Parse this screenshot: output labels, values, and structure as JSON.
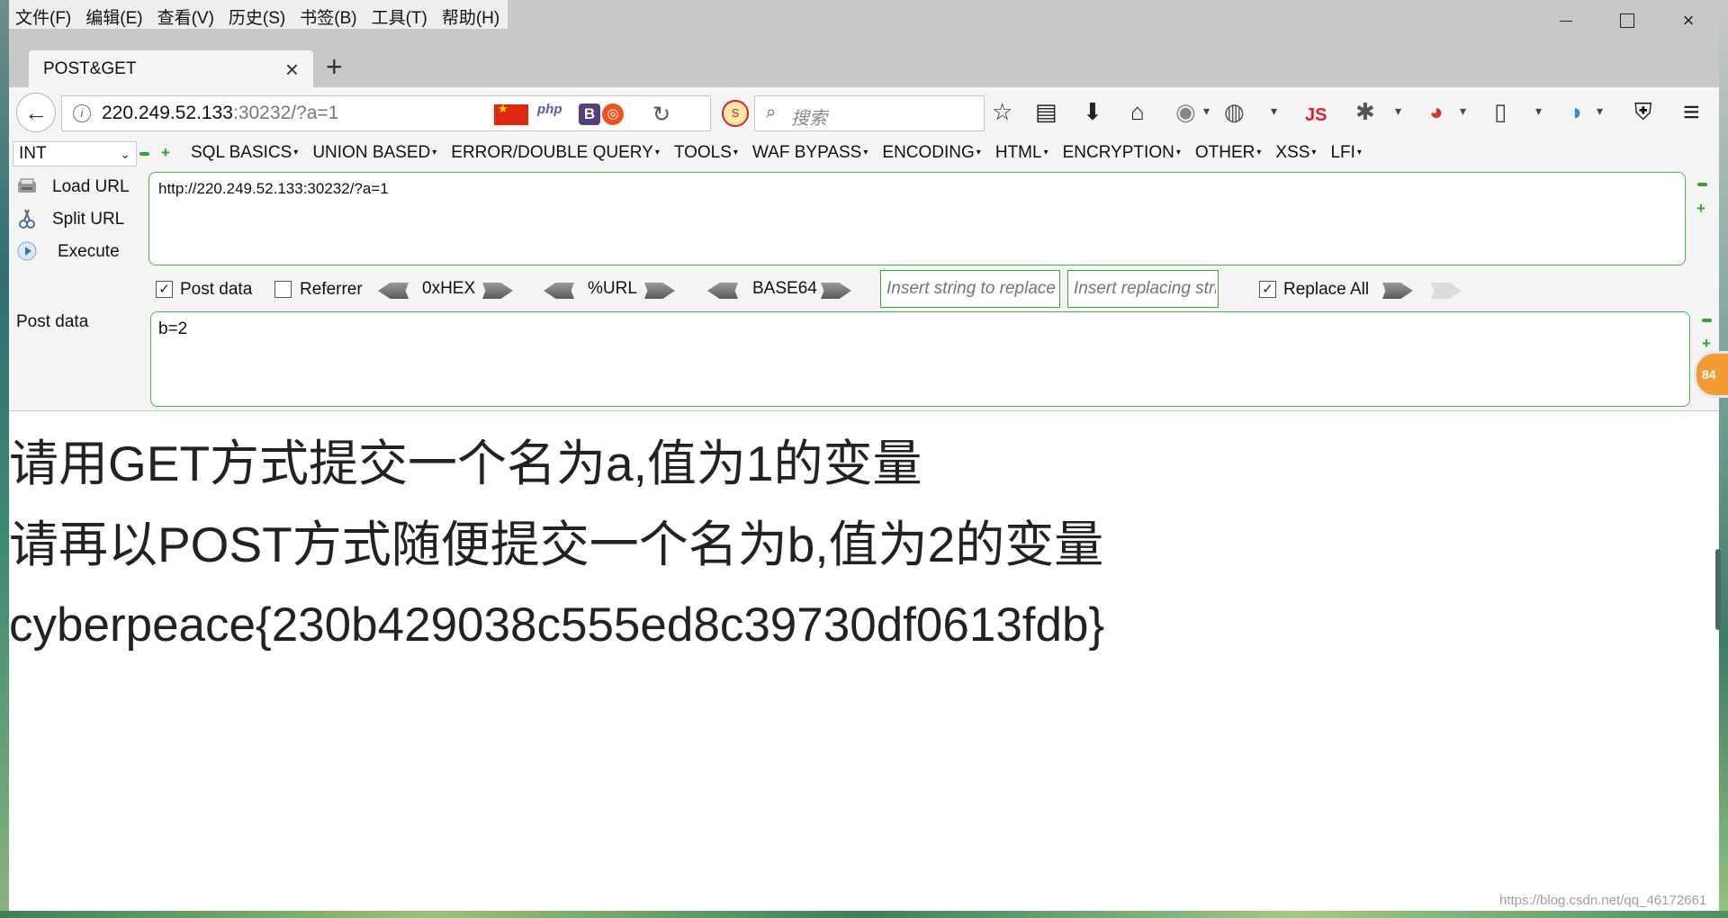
{
  "menu": [
    "文件(F)",
    "编辑(E)",
    "查看(V)",
    "历史(S)",
    "书签(B)",
    "工具(T)",
    "帮助(H)"
  ],
  "window": {
    "close_glyph": "×"
  },
  "tab": {
    "title": "POST&GET",
    "close_glyph": "×",
    "new_tab_glyph": "+"
  },
  "nav": {
    "back_glyph": "←",
    "info_glyph": "i",
    "url_host": "220.249.52.133",
    "url_rest": ":30232/?a=1",
    "php_label": "php",
    "b_label": "B",
    "ubuntu_glyph": "◎",
    "reload_glyph": "↻",
    "noscript_label": "S",
    "search_placeholder": "搜索",
    "search_glyph": "⌕",
    "js_label": "JS",
    "toolbar_glyphs": {
      "star": "☆",
      "library": "▤",
      "download": "⬇",
      "home": "⌂",
      "globe": "◉",
      "palette": "◍",
      "bug": "✱",
      "mask": "◕",
      "devices": "▯",
      "earth": "◑",
      "shield": "⛨",
      "menu": "≡",
      "dropdown": "▾"
    }
  },
  "hackbar": {
    "select_value": "INT",
    "select_arrow": "⌄",
    "menus": [
      "SQL BASICS",
      "UNION BASED",
      "ERROR/DOUBLE QUERY",
      "TOOLS",
      "WAF BYPASS",
      "ENCODING",
      "HTML",
      "ENCRYPTION",
      "OTHER",
      "XSS",
      "LFI"
    ],
    "load_url": "Load URL",
    "split_url": "Split URL",
    "execute": "Execute",
    "url_value": "http://220.249.52.133:30232/?a=1",
    "post_data_checkbox": "Post data",
    "post_data_checked": true,
    "referrer_checkbox": "Referrer",
    "referrer_checked": false,
    "hex_label": "0xHEX",
    "url_encode_label": "%URL",
    "base64_label": "BASE64",
    "replace_placeholder": "Insert string to replace",
    "replacing_placeholder": "Insert replacing string",
    "replace_all_label": "Replace All",
    "replace_all_checked": true,
    "check_glyph": "✓",
    "post_label": "Post data",
    "post_value": "b=2"
  },
  "content": {
    "line1": "请用GET方式提交一个名为a,值为1的变量",
    "line2": "请再以POST方式随便提交一个名为b,值为2的变量",
    "flag": "cyberpeace{230b429038c555ed8c39730df0613fdb}"
  },
  "badge": "84",
  "watermark": "https://blog.csdn.net/qq_46172661",
  "colors": {
    "accent_green": "#47b947",
    "js_red": "#e0202a",
    "flag_red": "#de2910"
  }
}
